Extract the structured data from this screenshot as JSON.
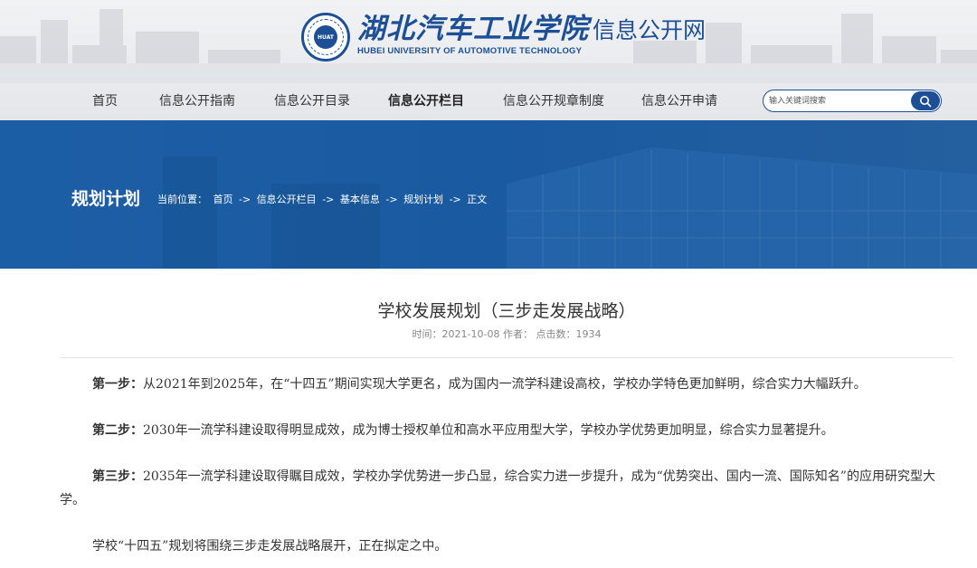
{
  "header": {
    "logo_cn": "湖北汽车工业学院",
    "logo_sub": "信息公开网",
    "logo_en": "HUBEI UNIVERSITY OF AUTOMOTIVE TECHNOLOGY",
    "emblem_text": "HUAT",
    "brand_color": "#1d4f96"
  },
  "nav": {
    "items": [
      {
        "label": "首页"
      },
      {
        "label": "信息公开指南"
      },
      {
        "label": "信息公开目录"
      },
      {
        "label": "信息公开栏目",
        "active": true
      },
      {
        "label": "信息公开规章制度"
      },
      {
        "label": "信息公开申请"
      }
    ]
  },
  "search": {
    "placeholder": "输入关键词搜索",
    "icon": "search-icon"
  },
  "banner": {
    "title": "规划计划",
    "breadcrumb_label": "当前位置：",
    "breadcrumb": [
      "首页",
      "信息公开栏目",
      "基本信息",
      "规划计划",
      "正文"
    ],
    "separator": "->",
    "color": "#1c5ea6"
  },
  "article": {
    "title": "学校发展规划（三步走发展战略）",
    "meta": "时间：2021-10-08 作者：   点击数：1934",
    "paragraphs": [
      {
        "label": "第一步：",
        "text": "从2021年到2025年，在“十四五”期间实现大学更名，成为国内一流学科建设高校，学校办学特色更加鲜明，综合实力大幅跃升。"
      },
      {
        "label": "第二步：",
        "text": "2030年一流学科建设取得明显成效，成为博士授权单位和高水平应用型大学，学校办学优势更加明显，综合实力显著提升。"
      },
      {
        "label": "第三步：",
        "text": "2035年一流学科建设取得瞩目成效，学校办学优势进一步凸显，综合实力进一步提升，成为“优势突出、国内一流、国际知名”的应用研究型大学。"
      },
      {
        "label": "",
        "text": "学校“十四五”规划将围绕三步走发展战略展开，正在拟定之中。"
      }
    ]
  }
}
